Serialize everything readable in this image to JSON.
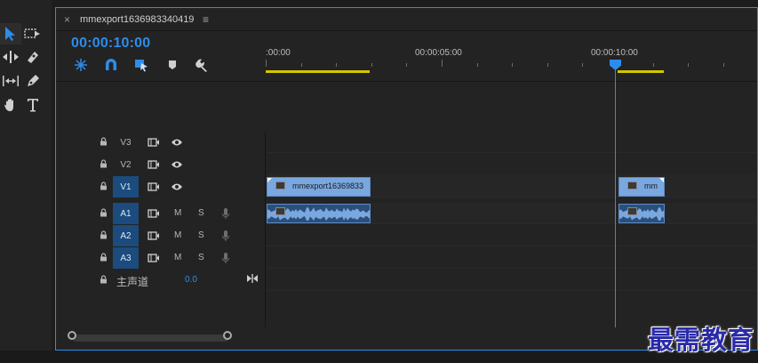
{
  "panel": {
    "close_label": "×",
    "tab_title": "mmexport1636983340419",
    "menu_label": "≡"
  },
  "timecode": "00:00:10:00",
  "ruler": {
    "ticks": [
      ":00:00",
      "00:00:05:00",
      "00:00:10:00"
    ]
  },
  "tracks": {
    "video": [
      {
        "name": "V3",
        "selected": false
      },
      {
        "name": "V2",
        "selected": false
      },
      {
        "name": "V1",
        "selected": true
      }
    ],
    "audio": [
      {
        "name": "A1",
        "mute": "M",
        "solo": "S"
      },
      {
        "name": "A2",
        "mute": "M",
        "solo": "S"
      },
      {
        "name": "A3",
        "mute": "M",
        "solo": "S"
      }
    ],
    "master": {
      "label": "主声道",
      "value": "0.0"
    }
  },
  "clips": {
    "video_1_label": "mmexport16369833",
    "video_2_label": "mm"
  },
  "colors": {
    "accent": "#2d8ceb",
    "clip_video": "#7aa7e0",
    "clip_audio": "#2c4f7a",
    "work_area": "#d3c700",
    "track_selected": "#1c4b7d"
  },
  "icons": {
    "tools": [
      "selection-tool-icon",
      "track-select-tool-icon",
      "ripple-edit-tool-icon",
      "razor-tool-icon",
      "slip-tool-icon",
      "pen-tool-icon",
      "hand-tool-icon",
      "type-tool-icon"
    ],
    "header": [
      "nest-sequence-icon",
      "snap-magnet-icon",
      "linked-selection-icon",
      "add-marker-icon",
      "wrench-settings-icon"
    ]
  },
  "watermark": "最需教育"
}
